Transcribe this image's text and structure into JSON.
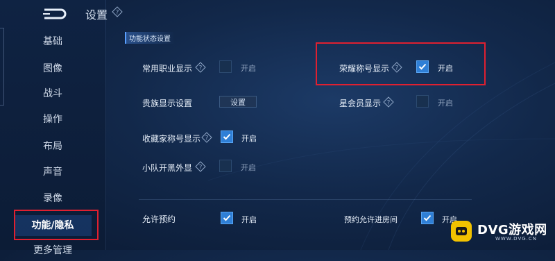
{
  "header": {
    "title": "设置"
  },
  "sidebar": {
    "items": [
      {
        "label": "基础"
      },
      {
        "label": "图像"
      },
      {
        "label": "战斗"
      },
      {
        "label": "操作"
      },
      {
        "label": "布局"
      },
      {
        "label": "声音"
      },
      {
        "label": "录像"
      },
      {
        "label": "功能/隐私",
        "active": true
      },
      {
        "label": "更多管理"
      }
    ]
  },
  "section": {
    "title": "功能状态设置"
  },
  "settings": {
    "profession": {
      "label": "常用职业显示",
      "state_label": "开启",
      "checked": false
    },
    "honor_title": {
      "label": "荣耀称号显示",
      "state_label": "开启",
      "checked": true
    },
    "noble": {
      "label": "贵族显示设置",
      "button_label": "设置"
    },
    "star_member": {
      "label": "星会员显示",
      "state_label": "开启",
      "checked": false
    },
    "collector": {
      "label": "收藏家称号显示",
      "state_label": "开启",
      "checked": true
    },
    "team_plugin": {
      "label": "小队开黑外显",
      "state_label": "开启",
      "checked": false
    },
    "allow_reserve": {
      "label": "允许预约",
      "state_label": "开启",
      "checked": true
    },
    "reserve_room": {
      "label": "预约允许进房间",
      "state_label": "开启",
      "checked": true
    }
  },
  "watermark": {
    "brand": "DVG游戏网",
    "domain": "WWW.DVG.CN"
  },
  "colors": {
    "highlight_border": "#e02030",
    "checkbox_on": "#2f7fd6",
    "accent": "#5aa0ff"
  }
}
